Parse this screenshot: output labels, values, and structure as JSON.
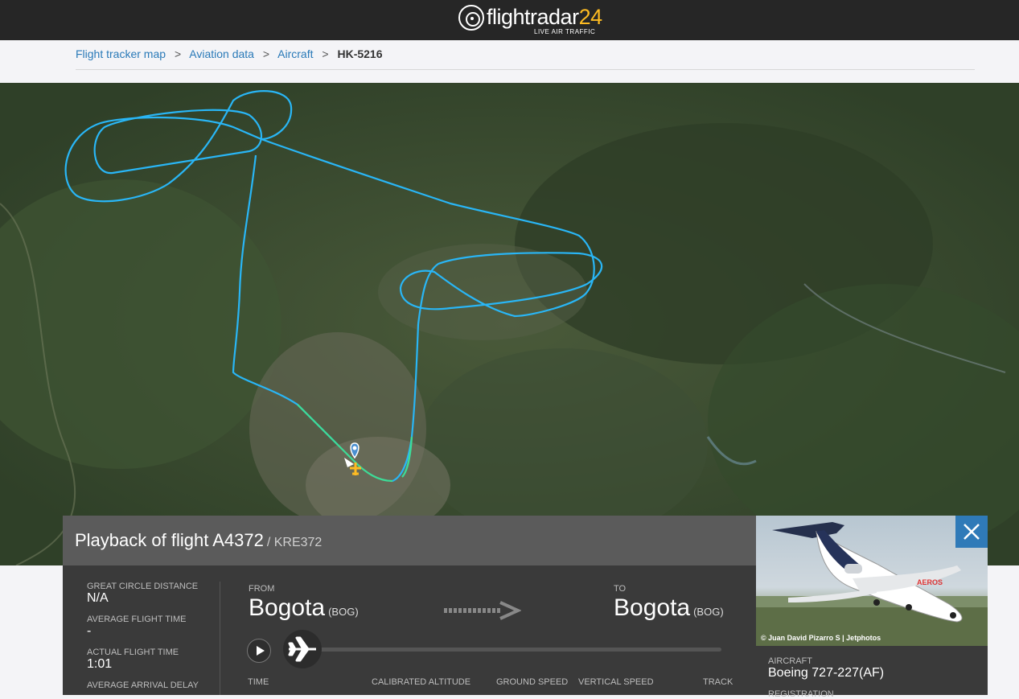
{
  "header": {
    "logo_main": "flightradar",
    "logo_num": "24",
    "logo_sub": "LIVE AIR TRAFFIC"
  },
  "breadcrumb": {
    "items": [
      "Flight tracker map",
      "Aviation data",
      "Aircraft"
    ],
    "current": "HK-5216",
    "separator": ">"
  },
  "playback": {
    "title": "Playback of flight A4372",
    "callsign": "/ KRE372",
    "stats": [
      {
        "label": "GREAT CIRCLE DISTANCE",
        "value": "N/A"
      },
      {
        "label": "AVERAGE FLIGHT TIME",
        "value": "-"
      },
      {
        "label": "ACTUAL FLIGHT TIME",
        "value": "1:01"
      },
      {
        "label": "AVERAGE ARRIVAL DELAY",
        "value": ""
      }
    ],
    "from_label": "FROM",
    "to_label": "TO",
    "from_city": "Bogota",
    "from_code": "(BOG)",
    "to_city": "Bogota",
    "to_code": "(BOG)",
    "columns": [
      "TIME",
      "CALIBRATED ALTITUDE",
      "GROUND SPEED",
      "VERTICAL SPEED",
      "TRACK"
    ]
  },
  "aircraft": {
    "photo_credit": "© Juan David Pizarro S | Jetphotos",
    "label": "AIRCRAFT",
    "value": "Boeing 727-227(AF)",
    "registration_label": "REGISTRATION"
  },
  "colors": {
    "track_high": "#29b6f6",
    "track_low": "#3ddc97",
    "accent_blue": "#2f7ab8",
    "header_bg": "#262626"
  }
}
